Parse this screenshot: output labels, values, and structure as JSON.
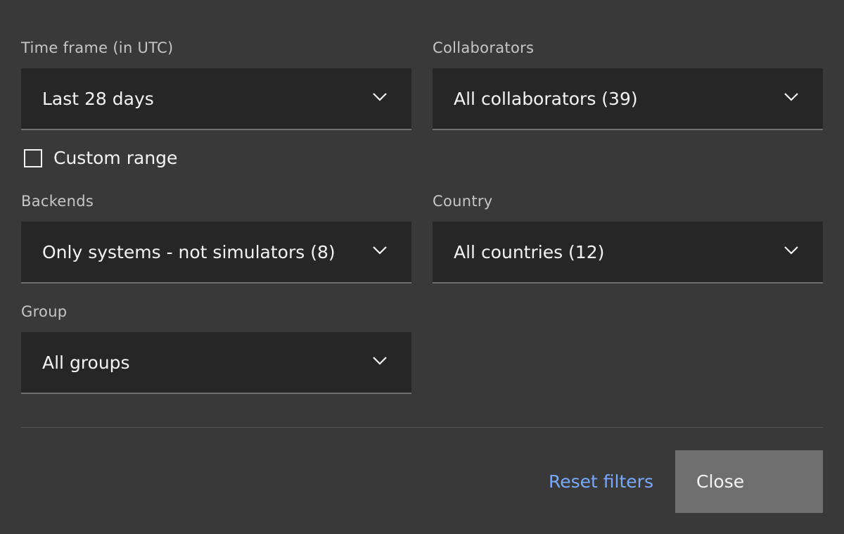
{
  "filters": {
    "time_frame": {
      "label": "Time frame (in UTC)",
      "value": "Last 28 days",
      "icon": "chevron-down-icon"
    },
    "collaborators": {
      "label": "Collaborators",
      "value": "All collaborators (39)",
      "icon": "chevron-down-icon"
    },
    "custom_range": {
      "label": "Custom range",
      "checked": false
    },
    "backends": {
      "label": "Backends",
      "value": "Only systems - not simulators (8)",
      "icon": "chevron-down-icon"
    },
    "country": {
      "label": "Country",
      "value": "All countries (12)",
      "icon": "chevron-down-icon"
    },
    "group": {
      "label": "Group",
      "value": "All groups",
      "icon": "chevron-down-icon"
    }
  },
  "actions": {
    "reset_label": "Reset filters",
    "close_label": "Close"
  },
  "colors": {
    "background": "#393939",
    "field_background": "#262626",
    "link": "#78a9ff",
    "secondary_button": "#6f6f6f"
  }
}
